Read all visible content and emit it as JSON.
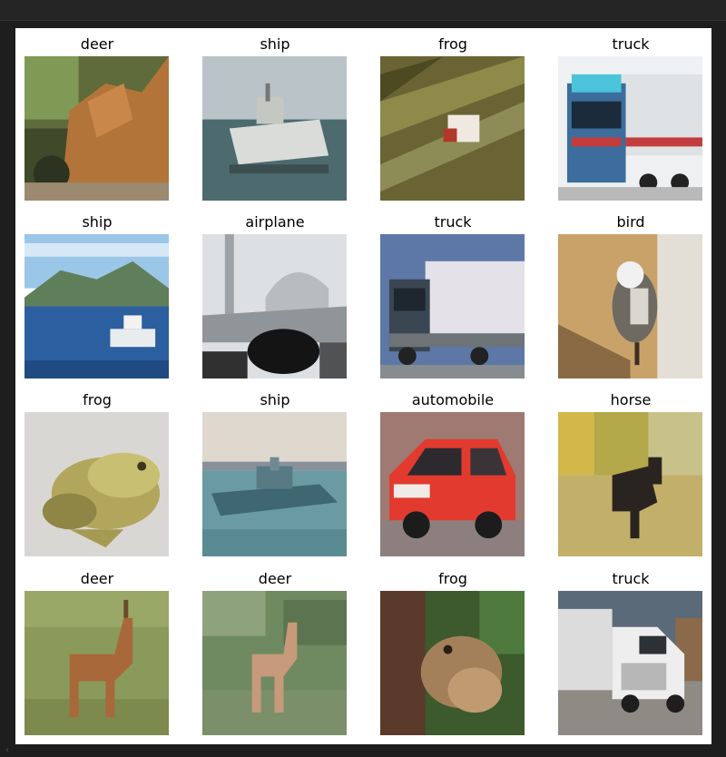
{
  "grid": {
    "items": [
      {
        "label": "deer",
        "icon": "deer-photo"
      },
      {
        "label": "ship",
        "icon": "ship-photo"
      },
      {
        "label": "frog",
        "icon": "frog-photo"
      },
      {
        "label": "truck",
        "icon": "truck-photo"
      },
      {
        "label": "ship",
        "icon": "ship-photo"
      },
      {
        "label": "airplane",
        "icon": "airplane-photo"
      },
      {
        "label": "truck",
        "icon": "truck-photo"
      },
      {
        "label": "bird",
        "icon": "bird-photo"
      },
      {
        "label": "frog",
        "icon": "frog-photo"
      },
      {
        "label": "ship",
        "icon": "ship-photo"
      },
      {
        "label": "automobile",
        "icon": "automobile-photo"
      },
      {
        "label": "horse",
        "icon": "horse-photo"
      },
      {
        "label": "deer",
        "icon": "deer-photo"
      },
      {
        "label": "deer",
        "icon": "deer-photo"
      },
      {
        "label": "frog",
        "icon": "frog-photo"
      },
      {
        "label": "truck",
        "icon": "truck-photo"
      }
    ]
  },
  "colors": {
    "page_background": "#1e1e1e",
    "panel_background": "#ffffff",
    "label_text": "#000000"
  }
}
